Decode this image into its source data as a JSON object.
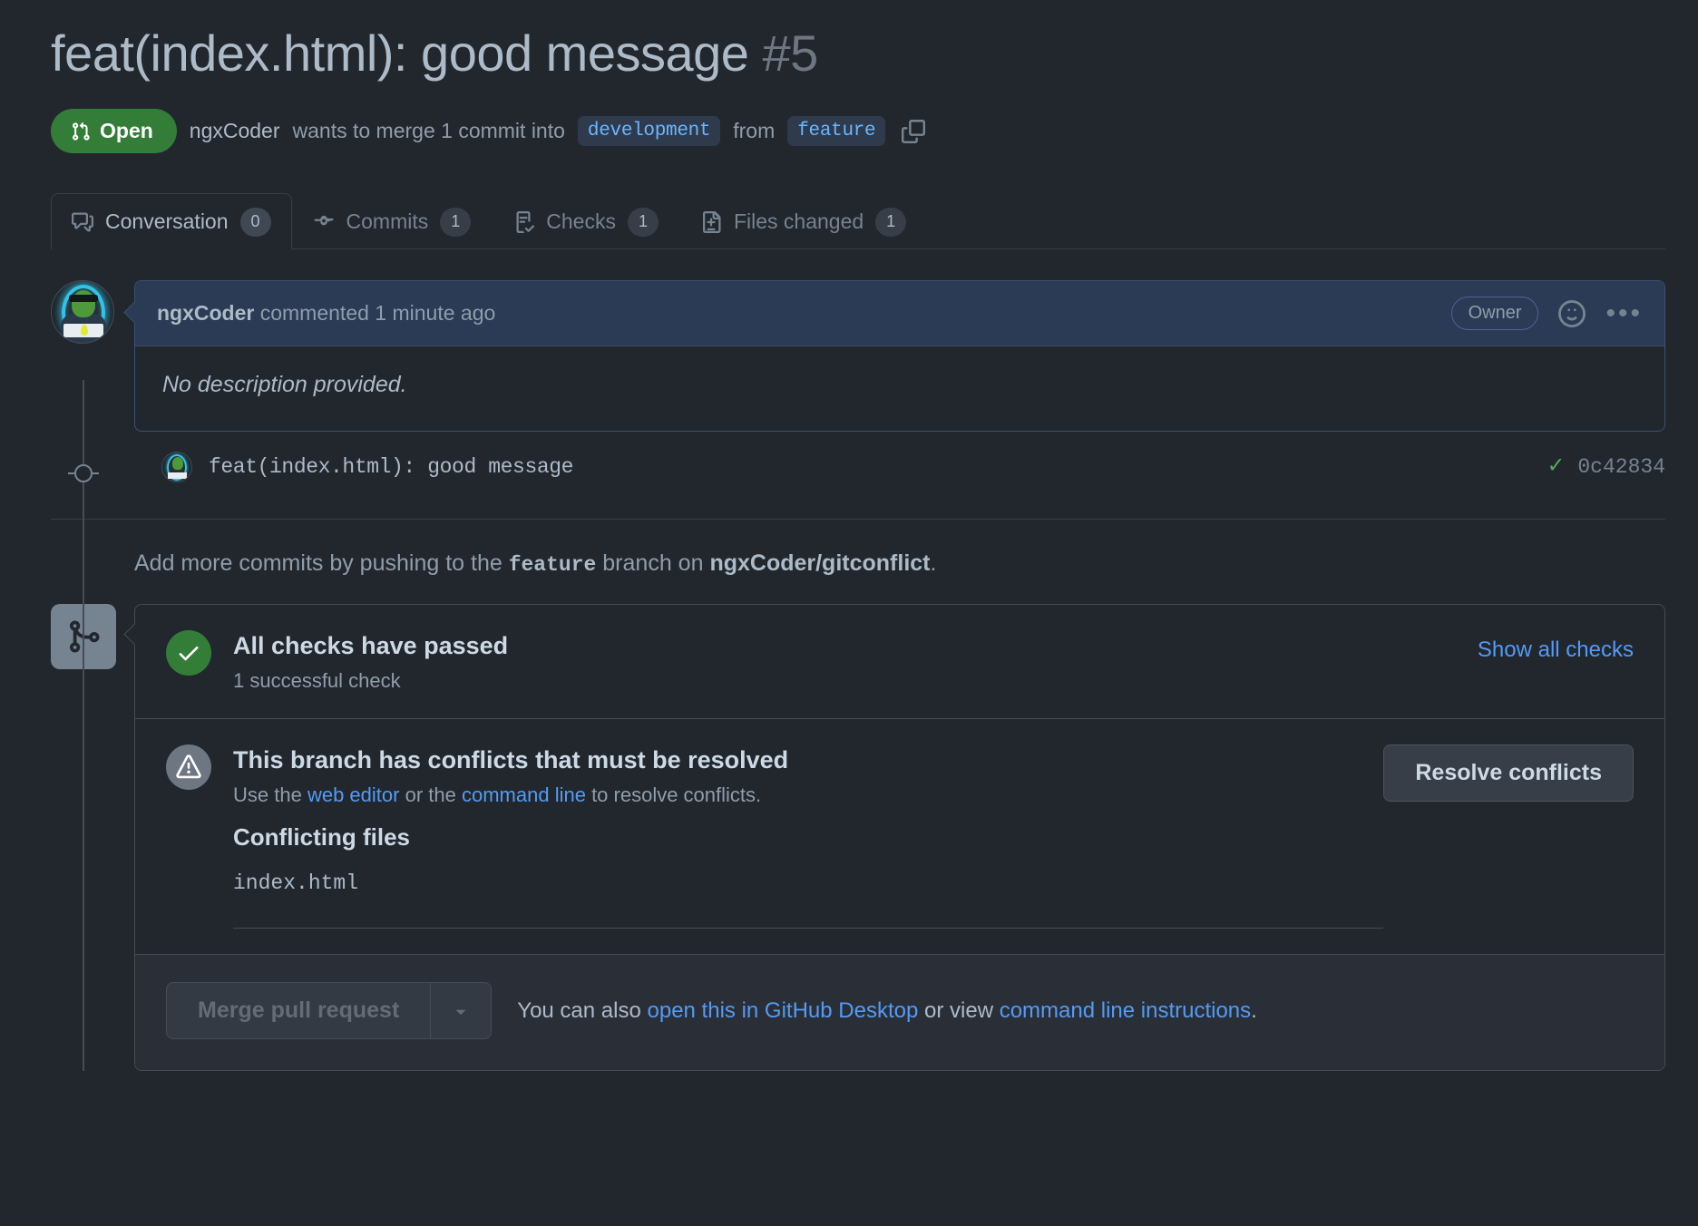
{
  "pr": {
    "title": "feat(index.html): good message",
    "number": "#5",
    "state": "Open",
    "state_color": "#347d39",
    "author": "ngxCoder",
    "merge_text_1": "wants to merge 1 commit into",
    "base_branch": "development",
    "merge_text_2": "from",
    "head_branch": "feature",
    "copy_icon": "copy-icon"
  },
  "tabs": [
    {
      "label": "Conversation",
      "count": "0",
      "icon": "comment-discussion-icon",
      "active": true
    },
    {
      "label": "Commits",
      "count": "1",
      "icon": "git-commit-icon",
      "active": false
    },
    {
      "label": "Checks",
      "count": "1",
      "icon": "checklist-icon",
      "active": false
    },
    {
      "label": "Files changed",
      "count": "1",
      "icon": "file-diff-icon",
      "active": false
    }
  ],
  "comment": {
    "author": "ngxCoder",
    "meta": "commented 1 minute ago",
    "role_badge": "Owner",
    "reaction_icon": "smiley-icon",
    "menu_icon": "kebab-horizontal-icon",
    "body": "No description provided."
  },
  "commit": {
    "message": "feat(index.html): good message",
    "status_icon": "check-icon",
    "status_color": "#57ab5a",
    "sha": "0c42834"
  },
  "push_note": {
    "prefix": "Add more commits by pushing to the",
    "branch": "feature",
    "middle": "branch on",
    "repo": "ngxCoder/gitconflict",
    "suffix": "."
  },
  "merge_box": {
    "icon": "git-merge-icon",
    "checks": {
      "icon": "check-circle-icon",
      "icon_color": "#347d39",
      "title": "All checks have passed",
      "subtitle": "1 successful check",
      "show_all_label": "Show all checks"
    },
    "conflicts": {
      "icon": "alert-circle-icon",
      "icon_color": "#6e7681",
      "title": "This branch has conflicts that must be resolved",
      "desc_prefix": "Use the",
      "link_web_editor": "web editor",
      "desc_middle": "or the",
      "link_command_line": "command line",
      "desc_suffix": "to resolve conflicts.",
      "files_heading": "Conflicting files",
      "files": [
        "index.html"
      ],
      "resolve_button": "Resolve conflicts"
    },
    "footer": {
      "merge_button": "Merge pull request",
      "caret_icon": "triangle-down-icon",
      "text_prefix": "You can also",
      "link_desktop": "open this in GitHub Desktop",
      "text_middle": "or view",
      "link_cli": "command line instructions",
      "text_suffix": "."
    }
  }
}
